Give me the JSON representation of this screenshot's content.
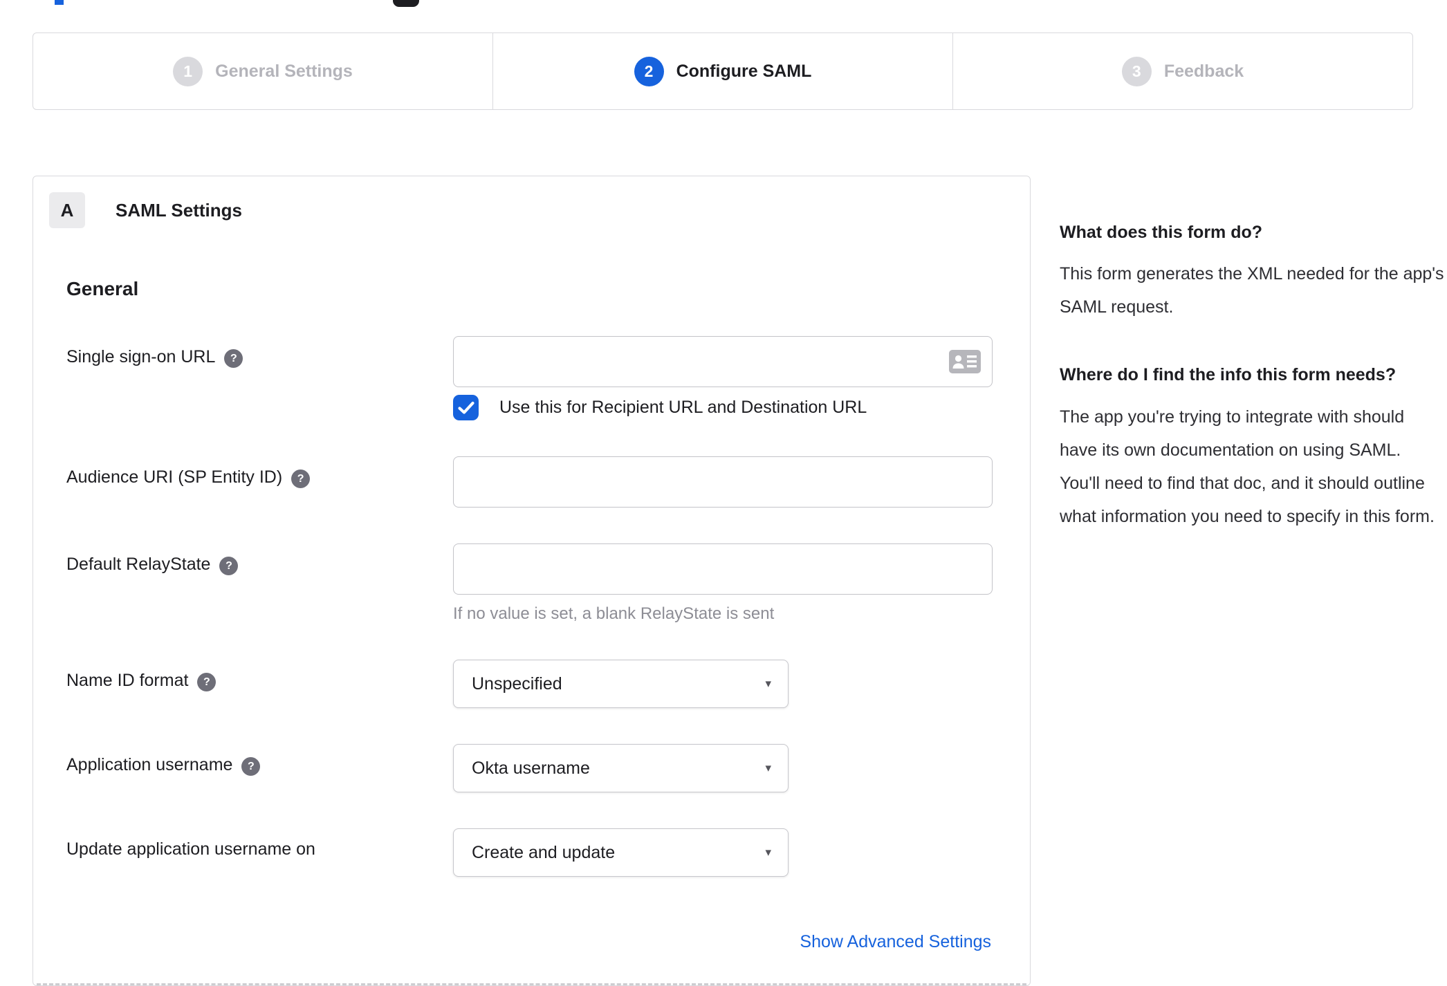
{
  "colors": {
    "accent": "#1662dd",
    "inactive_gray": "#d9d9dd",
    "inactive_text": "#b4b4ba",
    "dark_text": "#1d1d21",
    "muted_text": "#8d8d95",
    "link": "#1662dd"
  },
  "stepper": {
    "steps": [
      {
        "number": "1",
        "label": "General Settings",
        "state": "inactive"
      },
      {
        "number": "2",
        "label": "Configure SAML",
        "state": "active"
      },
      {
        "number": "3",
        "label": "Feedback",
        "state": "inactive"
      }
    ]
  },
  "panel": {
    "section_badge": "A",
    "section_title": "SAML Settings",
    "group_title": "General",
    "fields": [
      {
        "label": "Single sign-on URL",
        "value": "",
        "checkbox_label": "Use this for Recipient URL and Destination URL",
        "checkbox_checked": true
      },
      {
        "label": "Audience URI (SP Entity ID)",
        "value": ""
      },
      {
        "label": "Default RelayState",
        "value": "",
        "hint": "If no value is set, a blank RelayState is sent"
      },
      {
        "label": "Name ID format",
        "value": "Unspecified"
      },
      {
        "label": "Application username",
        "value": "Okta username"
      },
      {
        "label": "Update application username on",
        "value": "Create and update"
      }
    ],
    "advanced_link": "Show Advanced Settings"
  },
  "sidebar": {
    "sections": [
      {
        "heading": "What does this form do?",
        "body": "This form generates the XML needed for the app's SAML request."
      },
      {
        "heading": "Where do I find the info this form needs?",
        "body": "The app you're trying to integrate with should have its own documentation on using SAML. You'll need to find that doc, and it should outline what information you need to specify in this form."
      }
    ]
  }
}
